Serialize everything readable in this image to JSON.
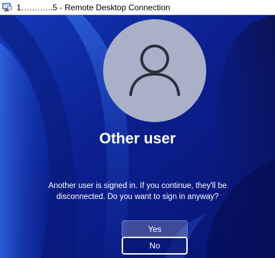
{
  "window": {
    "title": "1….……..5 - Remote Desktop Connection"
  },
  "lock_screen": {
    "username": "Other user",
    "message": "Another user is signed in. If you continue, they'll be disconnected. Do you want to sign in anyway?",
    "yes_label": "Yes",
    "no_label": "No"
  },
  "colors": {
    "wallpaper_base": "#0a1f8c",
    "avatar_fill": "#a9b0c8",
    "avatar_glyph": "#2b2f3a",
    "text": "#ffffff"
  },
  "icons": {
    "app": "remote-desktop-icon",
    "avatar": "user-silhouette-icon"
  }
}
